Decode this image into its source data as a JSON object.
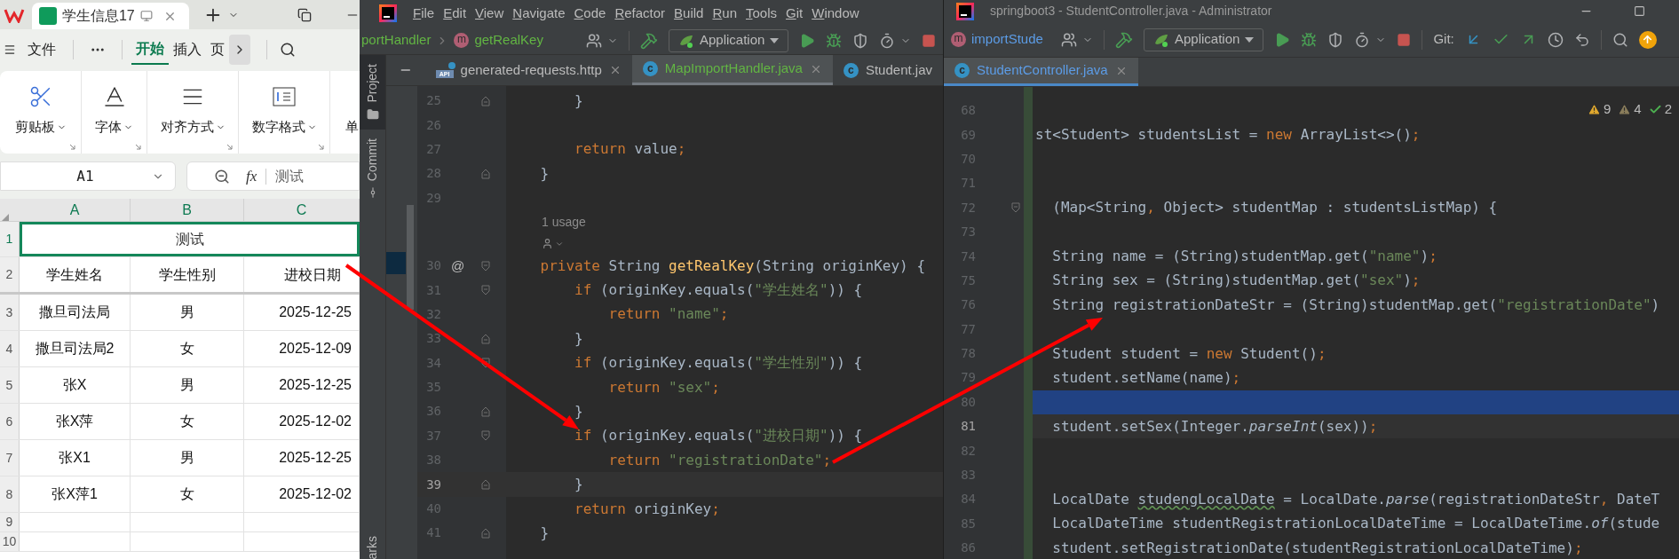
{
  "spreadsheet": {
    "tab": {
      "title": "学生信息17",
      "selected": true
    },
    "menu": [
      {
        "label": "文件",
        "selected": false
      },
      {
        "label": "开始",
        "selected": true
      },
      {
        "label": "插入",
        "selected": false
      },
      {
        "label": "页",
        "selected": false
      }
    ],
    "ribbon": [
      {
        "kind": "clipboard",
        "label": "剪贴板"
      },
      {
        "kind": "font",
        "label": "字体"
      },
      {
        "kind": "align",
        "label": "对齐方式"
      },
      {
        "kind": "number",
        "label": "数字格式"
      },
      {
        "kind": "cell",
        "label": "单"
      }
    ],
    "name_box": "A1",
    "fx": "fx",
    "formula": "测试",
    "columns": [
      "A",
      "B",
      "C"
    ],
    "rows": [
      {
        "number": "1",
        "kind": "title",
        "selected": true,
        "cells": [
          "测试"
        ]
      },
      {
        "number": "2",
        "kind": "header",
        "selected": false,
        "cells": [
          "学生姓名",
          "学生性别",
          "进校日期"
        ]
      },
      {
        "number": "3",
        "kind": "data",
        "selected": false,
        "cells": [
          "撒旦司法局",
          "男",
          "2025-12-25"
        ]
      },
      {
        "number": "4",
        "kind": "data",
        "selected": false,
        "cells": [
          "撒旦司法局2",
          "女",
          "2025-12-09"
        ]
      },
      {
        "number": "5",
        "kind": "data",
        "selected": false,
        "cells": [
          "张X",
          "男",
          "2025-12-25"
        ]
      },
      {
        "number": "6",
        "kind": "data",
        "selected": false,
        "cells": [
          "张X萍",
          "女",
          "2025-12-02"
        ]
      },
      {
        "number": "7",
        "kind": "data",
        "selected": false,
        "cells": [
          "张X1",
          "男",
          "2025-12-25"
        ]
      },
      {
        "number": "8",
        "kind": "data",
        "selected": false,
        "cells": [
          "张X萍1",
          "女",
          "2025-12-02"
        ]
      },
      {
        "number": "9",
        "kind": "empty",
        "selected": false
      },
      {
        "number": "10",
        "kind": "empty",
        "selected": false
      }
    ]
  },
  "ide_main": {
    "menu": [
      "File",
      "Edit",
      "View",
      "Navigate",
      "Code",
      "Refactor",
      "Build",
      "Run",
      "Tools",
      "Git",
      "Window"
    ],
    "breadcrumb": {
      "class": "portHandler",
      "method_icon": "m",
      "method": "getRealKey"
    },
    "run_config": "Application",
    "side_tabs": [
      {
        "label": "Project",
        "kind": "project",
        "selected": true
      },
      {
        "label": "Commit",
        "kind": "commit",
        "selected": false
      }
    ],
    "bottom_side_tab": "arks",
    "tabs": [
      {
        "label": "generated-requests.http",
        "kind": "http",
        "icon_text": "API",
        "color": "#bbbbbb",
        "closable": true,
        "selected": false
      },
      {
        "label": "MapImportHandler.java",
        "kind": "class",
        "icon_text": "c",
        "color": "#62b543",
        "closable": true,
        "selected": true
      },
      {
        "label": "Student.jav",
        "kind": "class",
        "icon_text": "c",
        "color": "#bbbbbb",
        "closable": false,
        "selected": false
      }
    ],
    "lines": [
      {
        "kind": "code",
        "number": "25",
        "fold": {
          "kind": "end"
        },
        "current": false,
        "code": [
          {
            "text": "        }",
            "kind": "plain"
          }
        ]
      },
      {
        "kind": "code",
        "number": "26",
        "current": false
      },
      {
        "kind": "code",
        "number": "27",
        "current": false,
        "code": [
          {
            "text": "        return ",
            "kind": "keyword"
          },
          {
            "text": "value",
            "kind": "plain"
          },
          {
            "text": ";",
            "kind": "keyword"
          }
        ]
      },
      {
        "kind": "code",
        "number": "28",
        "fold": {
          "kind": "end"
        },
        "current": false,
        "code": [
          {
            "text": "    }",
            "kind": "plain"
          }
        ]
      },
      {
        "kind": "code",
        "number": "29",
        "current": false
      },
      {
        "kind": "hint",
        "text": "1 usage"
      },
      {
        "kind": "author"
      },
      {
        "kind": "code",
        "number": "30",
        "marker": "@",
        "fold": {
          "kind": "start"
        },
        "current": false,
        "code": [
          {
            "text": "    private ",
            "kind": "keyword"
          },
          {
            "text": "String ",
            "kind": "plain"
          },
          {
            "text": "getRealKey",
            "kind": "method"
          },
          {
            "text": "(String originKey) {",
            "kind": "plain"
          }
        ]
      },
      {
        "kind": "code",
        "number": "31",
        "fold": {
          "kind": "start"
        },
        "current": false,
        "code": [
          {
            "text": "        if ",
            "kind": "keyword"
          },
          {
            "text": "(originKey.equals(",
            "kind": "plain"
          },
          {
            "text": "\"学生姓名\"",
            "kind": "string"
          },
          {
            "text": ")) {",
            "kind": "plain"
          }
        ]
      },
      {
        "kind": "code",
        "number": "32",
        "current": false,
        "code": [
          {
            "text": "            return ",
            "kind": "keyword"
          },
          {
            "text": "\"name\"",
            "kind": "string"
          },
          {
            "text": ";",
            "kind": "keyword"
          }
        ]
      },
      {
        "kind": "code",
        "number": "33",
        "fold": {
          "kind": "end"
        },
        "current": false,
        "code": [
          {
            "text": "        }",
            "kind": "plain"
          }
        ]
      },
      {
        "kind": "code",
        "number": "34",
        "fold": {
          "kind": "start"
        },
        "current": false,
        "code": [
          {
            "text": "        if ",
            "kind": "keyword"
          },
          {
            "text": "(originKey.equals(",
            "kind": "plain"
          },
          {
            "text": "\"学生性别\"",
            "kind": "string"
          },
          {
            "text": ")) {",
            "kind": "plain"
          }
        ]
      },
      {
        "kind": "code",
        "number": "35",
        "current": false,
        "code": [
          {
            "text": "            return ",
            "kind": "keyword"
          },
          {
            "text": "\"sex\"",
            "kind": "string"
          },
          {
            "text": ";",
            "kind": "keyword"
          }
        ]
      },
      {
        "kind": "code",
        "number": "36",
        "fold": {
          "kind": "end"
        },
        "current": false,
        "code": [
          {
            "text": "        }",
            "kind": "plain"
          }
        ]
      },
      {
        "kind": "code",
        "number": "37",
        "fold": {
          "kind": "start"
        },
        "current": false,
        "code": [
          {
            "text": "        if ",
            "kind": "keyword"
          },
          {
            "text": "(originKey.equals(",
            "kind": "plain"
          },
          {
            "text": "\"进校日期\"",
            "kind": "string"
          },
          {
            "text": ")) {",
            "kind": "plain"
          }
        ]
      },
      {
        "kind": "code",
        "number": "38",
        "current": false,
        "code": [
          {
            "text": "            return ",
            "kind": "keyword"
          },
          {
            "text": "\"registrationDate\"",
            "kind": "string"
          },
          {
            "text": ";",
            "kind": "keyword"
          }
        ]
      },
      {
        "kind": "code",
        "number": "39",
        "fold": {
          "kind": "end"
        },
        "current": true,
        "code": [
          {
            "text": "        }",
            "kind": "plain"
          }
        ]
      },
      {
        "kind": "code",
        "number": "40",
        "current": false,
        "code": [
          {
            "text": "        return ",
            "kind": "keyword"
          },
          {
            "text": "originKey",
            "kind": "plain"
          },
          {
            "text": ";",
            "kind": "keyword"
          }
        ]
      },
      {
        "kind": "code",
        "number": "41",
        "fold": {
          "kind": "end"
        },
        "current": false,
        "code": [
          {
            "text": "    }",
            "kind": "plain"
          }
        ]
      }
    ]
  },
  "ide_side": {
    "title": "springboot3 - StudentController.java - Administrator",
    "breadcrumb": {
      "method_icon": "m",
      "method": "importStude"
    },
    "run_config": "Application",
    "git_label": "Git:",
    "tabs": [
      {
        "label": "StudentController.java",
        "kind": "class",
        "icon_text": "c",
        "color": "#5c9ce6",
        "closable": true,
        "selected": true
      }
    ],
    "inspections": [
      {
        "kind": "warning",
        "count": "9"
      },
      {
        "kind": "weak",
        "count": "4"
      },
      {
        "kind": "typo",
        "count": "2"
      }
    ],
    "lines": [
      {
        "number": "68",
        "current": false,
        "highlighted": false
      },
      {
        "number": "69",
        "current": false,
        "highlighted": false,
        "code": [
          {
            "text": "st<Student> studentsList = ",
            "kind": "plain"
          },
          {
            "text": "new ",
            "kind": "keyword"
          },
          {
            "text": "ArrayList<>()",
            "kind": "plain"
          },
          {
            "text": ";",
            "kind": "keyword"
          }
        ]
      },
      {
        "number": "70",
        "current": false,
        "highlighted": false
      },
      {
        "number": "71",
        "current": false,
        "highlighted": false
      },
      {
        "number": "72",
        "fold": {
          "kind": "start"
        },
        "current": false,
        "highlighted": false,
        "code": [
          {
            "text": "  (Map<String",
            "kind": "plain"
          },
          {
            "text": ", ",
            "kind": "keyword"
          },
          {
            "text": "Object> studentMap : studentsListMap) {",
            "kind": "plain"
          }
        ]
      },
      {
        "number": "73",
        "current": false,
        "highlighted": false
      },
      {
        "number": "74",
        "current": false,
        "highlighted": false,
        "code": [
          {
            "text": "  String name = (String)studentMap.get(",
            "kind": "plain"
          },
          {
            "text": "\"name\"",
            "kind": "string"
          },
          {
            "text": ")",
            "kind": "plain"
          },
          {
            "text": ";",
            "kind": "keyword"
          }
        ]
      },
      {
        "number": "75",
        "current": false,
        "highlighted": false,
        "code": [
          {
            "text": "  String sex = (String)studentMap.get(",
            "kind": "plain"
          },
          {
            "text": "\"sex\"",
            "kind": "string"
          },
          {
            "text": ")",
            "kind": "plain"
          },
          {
            "text": ";",
            "kind": "keyword"
          }
        ]
      },
      {
        "number": "76",
        "current": false,
        "highlighted": false,
        "code": [
          {
            "text": "  String registrationDateStr = (String)studentMap.get(",
            "kind": "plain"
          },
          {
            "text": "\"registrationDate\"",
            "kind": "string"
          },
          {
            "text": ")",
            "kind": "plain"
          }
        ]
      },
      {
        "number": "77",
        "current": false,
        "highlighted": false
      },
      {
        "number": "78",
        "current": false,
        "highlighted": false,
        "code": [
          {
            "text": "  Student student = ",
            "kind": "plain"
          },
          {
            "text": "new ",
            "kind": "keyword"
          },
          {
            "text": "Student()",
            "kind": "plain"
          },
          {
            "text": ";",
            "kind": "keyword"
          }
        ]
      },
      {
        "number": "79",
        "current": false,
        "highlighted": false,
        "code": [
          {
            "text": "  student.setName(name)",
            "kind": "plain"
          },
          {
            "text": ";",
            "kind": "keyword"
          }
        ]
      },
      {
        "number": "80",
        "current": false,
        "highlighted": true
      },
      {
        "number": "81",
        "current": true,
        "highlighted": false,
        "code": [
          {
            "text": "  student.setSex(Integer.",
            "kind": "plain"
          },
          {
            "text": "parseInt",
            "kind": "static"
          },
          {
            "text": "(sex))",
            "kind": "plain"
          },
          {
            "text": ";",
            "kind": "keyword"
          }
        ]
      },
      {
        "number": "82",
        "current": false,
        "highlighted": false
      },
      {
        "number": "83",
        "current": false,
        "highlighted": false
      },
      {
        "number": "84",
        "current": false,
        "highlighted": false,
        "code": [
          {
            "text": "  LocalDate ",
            "kind": "plain"
          },
          {
            "text": "studengLocalDate",
            "kind": "typo"
          },
          {
            "text": " = LocalDate.",
            "kind": "plain"
          },
          {
            "text": "parse",
            "kind": "static"
          },
          {
            "text": "(registrationDateStr",
            "kind": "plain"
          },
          {
            "text": ", ",
            "kind": "keyword"
          },
          {
            "text": "DateT",
            "kind": "plain"
          }
        ]
      },
      {
        "number": "85",
        "current": false,
        "highlighted": false,
        "code": [
          {
            "text": "  LocalDateTime studentRegistrationLocalDateTime = LocalDateTime.",
            "kind": "plain"
          },
          {
            "text": "of",
            "kind": "static"
          },
          {
            "text": "(stude",
            "kind": "plain"
          }
        ]
      },
      {
        "number": "86",
        "current": false,
        "highlighted": false,
        "code": [
          {
            "text": "  student.setRegistrationDate(studentRegistrationLocalDateTime)",
            "kind": "plain"
          },
          {
            "text": ";",
            "kind": "keyword"
          }
        ]
      }
    ]
  }
}
